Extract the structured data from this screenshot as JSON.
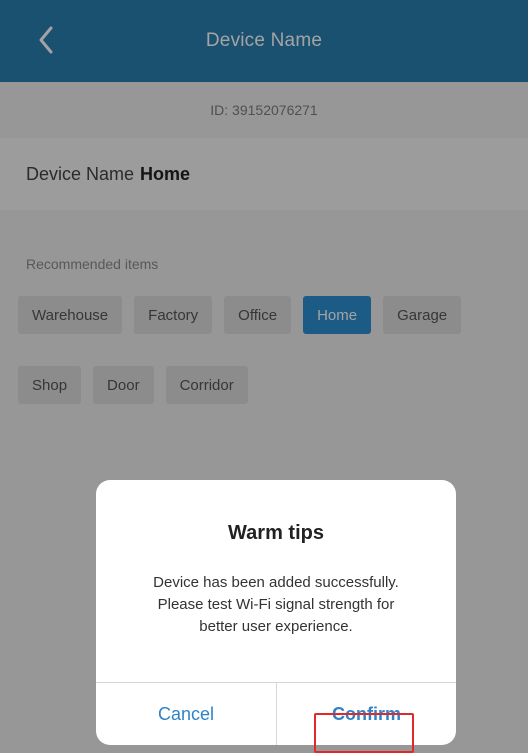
{
  "header": {
    "title": "Device Name"
  },
  "device": {
    "id_text": "ID: 39152076271",
    "name_label": "Device Name",
    "name_value": "Home"
  },
  "recommended": {
    "label": "Recommended items",
    "row1": [
      "Warehouse",
      "Factory",
      "Office",
      "Home",
      "Garage"
    ],
    "row2": [
      "Shop",
      "Door",
      "Corridor"
    ],
    "selected": "Home"
  },
  "dialog": {
    "title": "Warm tips",
    "message_lines": [
      "Device has been added successfully.",
      "Please test Wi-Fi signal strength for",
      "better user experience."
    ],
    "cancel_label": "Cancel",
    "confirm_label": "Confirm"
  },
  "colors": {
    "header": "#2b7fb0",
    "accent": "#2d8fd0",
    "highlight_border": "#e02a2a"
  },
  "icons": {
    "back": "chevron-left-icon"
  }
}
